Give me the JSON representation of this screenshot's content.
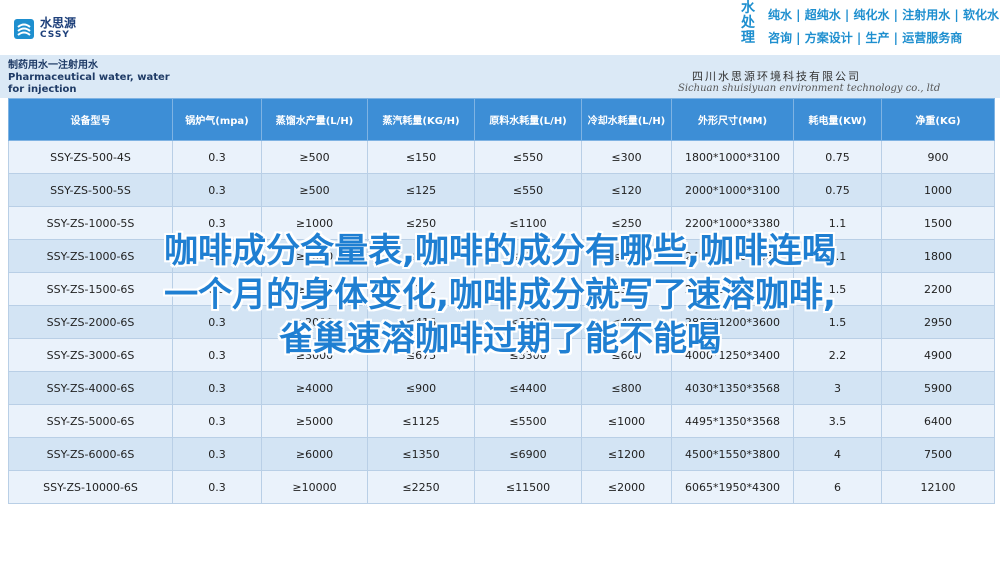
{
  "brand": {
    "name_cn": "水思源",
    "name_en": "CSSY",
    "vertical": [
      "水",
      "处",
      "理"
    ],
    "slogan1": "纯水 | 超纯水 | 纯化水 | 注射用水 | 软化水",
    "slogan2": "咨询 | 方案设计 | 生产 | 运营服务商"
  },
  "product_title": "制药用水一注射用水 Pharmaceutical water, water for injection",
  "company": {
    "cn": "四川水思源环境科技有限公司",
    "en": "Sichuan shuisiyuan environment technology co., ltd"
  },
  "table": {
    "headers": [
      "设备型号",
      "锅炉气(mpa)",
      "蒸馏水产量(L/H)",
      "蒸汽耗量(KG/H)",
      "原料水耗量(L/H)",
      "冷却水耗量(L/H)",
      "外形尺寸(MM)",
      "耗电量(KW)",
      "净重(KG)"
    ],
    "rows": [
      [
        "SSY-ZS-500-4S",
        "0.3",
        "≥500",
        "≤150",
        "≤550",
        "≤300",
        "1800*1000*3100",
        "0.75",
        "900"
      ],
      [
        "SSY-ZS-500-5S",
        "0.3",
        "≥500",
        "≤125",
        "≤550",
        "≤120",
        "2000*1000*3100",
        "0.75",
        "1000"
      ],
      [
        "SSY-ZS-1000-5S",
        "0.3",
        "≥1000",
        "≤250",
        "≤1100",
        "≤250",
        "2200*1000*3380",
        "1.1",
        "1500"
      ],
      [
        "SSY-ZS-1000-6S",
        "0.3",
        "≥1000",
        "≤208",
        "≤1100",
        "≤200",
        "2400*1000*3380",
        "1.1",
        "1800"
      ],
      [
        "SSY-ZS-1500-6S",
        "0.3",
        "≥1500",
        "≤312",
        "≤1650",
        "≤300",
        "2600*1100*3500",
        "1.5",
        "2200"
      ],
      [
        "SSY-ZS-2000-6S",
        "0.3",
        "≥2000",
        "≤416",
        "≤2200",
        "≤400",
        "2800*1200*3600",
        "1.5",
        "2950"
      ],
      [
        "SSY-ZS-3000-6S",
        "0.3",
        "≥3000",
        "≤675",
        "≤3300",
        "≤600",
        "4000*1250*3400",
        "2.2",
        "4900"
      ],
      [
        "SSY-ZS-4000-6S",
        "0.3",
        "≥4000",
        "≤900",
        "≤4400",
        "≤800",
        "4030*1350*3568",
        "3",
        "5900"
      ],
      [
        "SSY-ZS-5000-6S",
        "0.3",
        "≥5000",
        "≤1125",
        "≤5500",
        "≤1000",
        "4495*1350*3568",
        "3.5",
        "6400"
      ],
      [
        "SSY-ZS-6000-6S",
        "0.3",
        "≥6000",
        "≤1350",
        "≤6900",
        "≤1200",
        "4500*1550*3800",
        "4",
        "7500"
      ],
      [
        "SSY-ZS-10000-6S",
        "0.3",
        "≥10000",
        "≤2250",
        "≤11500",
        "≤2000",
        "6065*1950*4300",
        "6",
        "12100"
      ]
    ]
  },
  "overlay_lines": [
    "咖啡成分含量表,咖啡的成分有哪些,咖啡连喝",
    "一个月的身体变化,咖啡成分就写了速溶咖啡,",
    "雀巢速溶咖啡过期了能不能喝"
  ],
  "colors": {
    "header_blue": "#3d8ed6",
    "row_light": "#eaf2fb",
    "row_dark": "#d3e4f4",
    "overlay_text": "#1f7fd2"
  }
}
